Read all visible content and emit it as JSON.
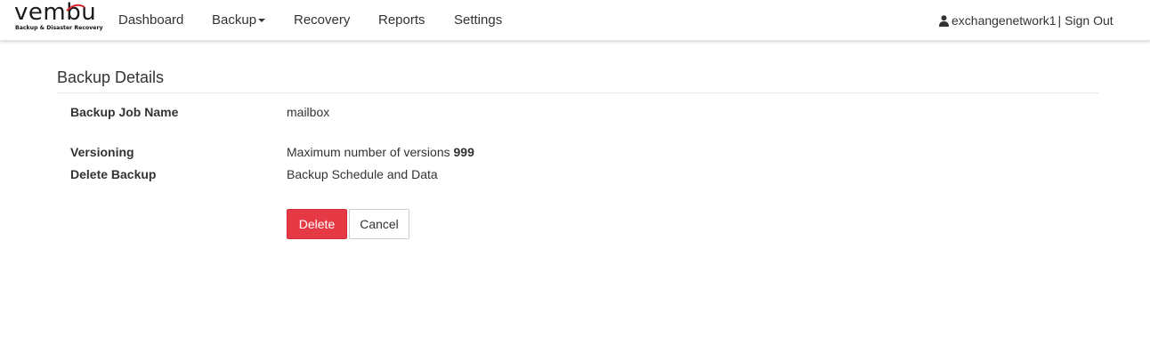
{
  "brand": {
    "name": "vembu",
    "tagline": "Backup & Disaster Recovery"
  },
  "nav": {
    "items": [
      {
        "label": "Dashboard"
      },
      {
        "label": "Backup",
        "has_dropdown": true
      },
      {
        "label": "Recovery"
      },
      {
        "label": "Reports"
      },
      {
        "label": "Settings"
      }
    ]
  },
  "user": {
    "icon": "user-icon",
    "name": "exchangenetwork1",
    "separator": "|",
    "signout_label": "Sign Out"
  },
  "details": {
    "title": "Backup Details",
    "job_name_label": "Backup Job Name",
    "job_name_value": "mailbox",
    "versioning_label": "Versioning",
    "versioning_text": "Maximum number of versions",
    "versioning_count": "999",
    "delete_label": "Delete Backup",
    "delete_value": "Backup Schedule and Data"
  },
  "actions": {
    "delete_label": "Delete",
    "cancel_label": "Cancel"
  },
  "colors": {
    "accent_danger": "#e63946",
    "text": "#333333",
    "logo_swoosh": "#d9262b"
  }
}
